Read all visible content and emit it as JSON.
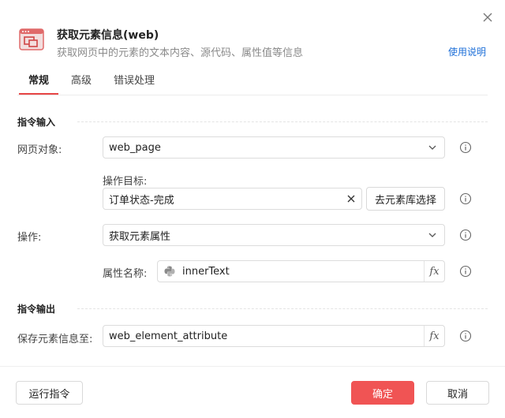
{
  "dialog": {
    "title": "获取元素信息(web)",
    "subtitle": "获取网页中的元素的文本内容、源代码、属性值等信息",
    "help_link": "使用说明",
    "close_icon": "close-icon",
    "header_icon": "web-window-icon"
  },
  "tabs": [
    {
      "label": "常规",
      "active": true
    },
    {
      "label": "高级",
      "active": false
    },
    {
      "label": "错误处理",
      "active": false
    }
  ],
  "input_section": {
    "title": "指令输入",
    "web_object": {
      "label": "网页对象:",
      "value": "web_page"
    },
    "target": {
      "label": "操作目标:",
      "value": "订单状态-完成",
      "picker_button": "去元素库选择"
    },
    "operation": {
      "label": "操作:",
      "value": "获取元素属性"
    },
    "attribute_name": {
      "label": "属性名称:",
      "value": "innerText"
    }
  },
  "output_section": {
    "title": "指令输出",
    "save_to": {
      "label": "保存元素信息至:",
      "value": "web_element_attribute"
    }
  },
  "fx_label": "fx",
  "footer": {
    "run_button": "运行指令",
    "confirm_button": "确定",
    "cancel_button": "取消"
  },
  "colors": {
    "accent": "#f05454",
    "link": "#1d6fd8"
  }
}
